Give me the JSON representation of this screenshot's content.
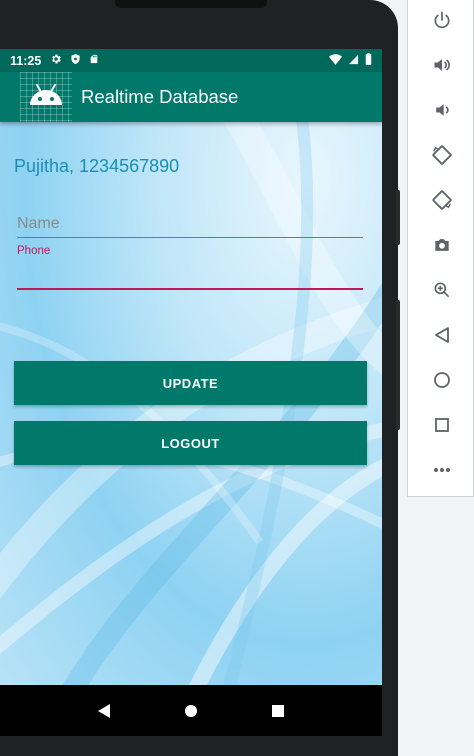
{
  "status_bar": {
    "time": "11:25",
    "icons": [
      "settings-icon",
      "shield-icon",
      "sd-card-icon",
      "wifi-icon",
      "signal-icon",
      "battery-icon"
    ]
  },
  "app_bar": {
    "title": "Realtime Database",
    "logo_icon": "android-icon"
  },
  "main": {
    "greeting": "Pujitha, 1234567890",
    "name_field": {
      "placeholder": "Name",
      "value": ""
    },
    "phone_field": {
      "label": "Phone",
      "value": ""
    },
    "update_label": "UPDATE",
    "logout_label": "LOGOUT"
  },
  "nav_bar": {
    "buttons": [
      "back-icon",
      "home-icon",
      "recents-icon"
    ]
  },
  "emulator_toolbar": {
    "tools": [
      "power-icon",
      "volume-up-icon",
      "volume-down-icon",
      "rotate-left-icon",
      "rotate-right-icon",
      "camera-icon",
      "zoom-icon",
      "back-icon",
      "home-icon",
      "overview-icon",
      "more-icon"
    ]
  },
  "colors": {
    "primary": "#00796b",
    "primary_dark": "#00695c",
    "accent": "#c2185b",
    "greeting_text": "#1a8fb5"
  }
}
